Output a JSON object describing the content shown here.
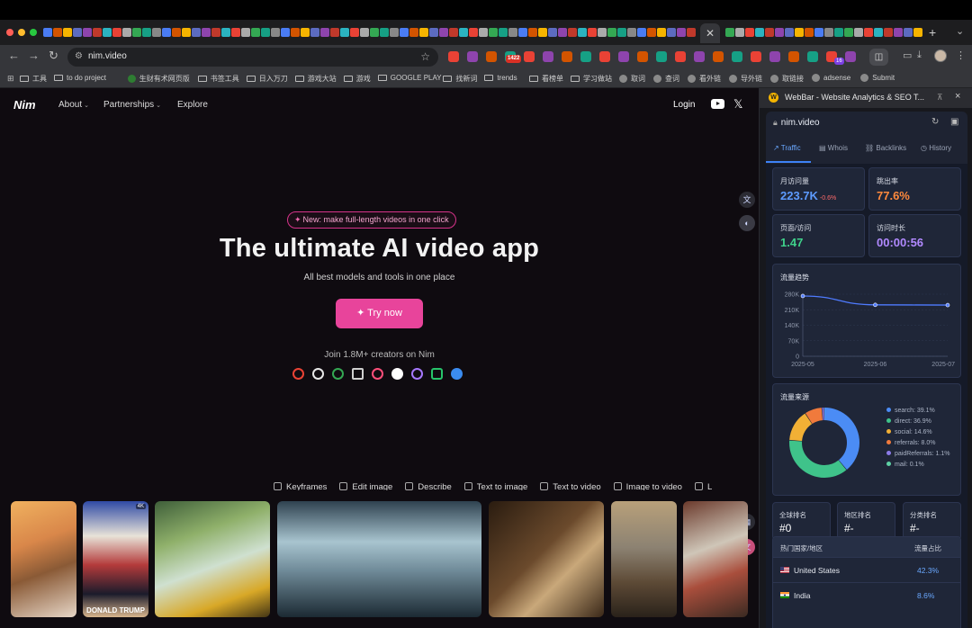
{
  "browser": {
    "url": "nim.video",
    "ext_badge_1": "1422",
    "ext_badge_2": "16",
    "bookmarks": [
      {
        "label": "工具",
        "kind": "folder"
      },
      {
        "label": "to do project",
        "kind": "folder"
      },
      {
        "label": "生财有术网页版",
        "kind": "leaf"
      },
      {
        "label": "书签工具",
        "kind": "folder"
      },
      {
        "label": "日入万刀",
        "kind": "folder"
      },
      {
        "label": "游戏大站",
        "kind": "folder"
      },
      {
        "label": "游戏",
        "kind": "folder"
      },
      {
        "label": "GOOGLE PLAY",
        "kind": "folder"
      },
      {
        "label": "找新词",
        "kind": "folder"
      },
      {
        "label": "trends",
        "kind": "folder"
      },
      {
        "label": "看榜单",
        "kind": "folder"
      },
      {
        "label": "学习做站",
        "kind": "folder"
      },
      {
        "label": "取词",
        "kind": "globe"
      },
      {
        "label": "查词",
        "kind": "globe"
      },
      {
        "label": "看外链",
        "kind": "globe"
      },
      {
        "label": "导外链",
        "kind": "globe"
      },
      {
        "label": "取链接",
        "kind": "globe"
      },
      {
        "label": "adsense",
        "kind": "globe"
      },
      {
        "label": "Submit",
        "kind": "globe"
      }
    ]
  },
  "site": {
    "logo": "Nim",
    "nav": {
      "about": "About",
      "partnerships": "Partnerships",
      "explore": "Explore",
      "login": "Login"
    },
    "pill": "New: make full-length videos in one click",
    "headline": "The ultimate AI video app",
    "subline": "All best models and tools in one place",
    "cta": "Try now",
    "join": "Join 1.8M+ creators on Nim",
    "tools": [
      "Keyframes",
      "Edit image",
      "Describe",
      "Text to image",
      "Text to video",
      "Image to video",
      "L"
    ],
    "gallery_caption": "DONALD TRUMP",
    "gallery_badge": "4K"
  },
  "panel": {
    "title": "WebBar - Website Analytics & SEO T...",
    "domain": "nim.video",
    "tabs": [
      "Traffic",
      "Whois",
      "Backlinks",
      "History"
    ],
    "stats": {
      "monthly_visits_label": "月访问量",
      "monthly_visits_value": "223.7K",
      "monthly_visits_change": "-0.6%",
      "bounce_label": "跳出率",
      "bounce_value": "77.6%",
      "pages_label": "页面/访问",
      "pages_value": "1.47",
      "duration_label": "访问时长",
      "duration_value": "00:00:56"
    },
    "trend_title": "流量趋势",
    "source_title": "流量来源",
    "ranks": [
      {
        "label": "全球排名",
        "value": "#0"
      },
      {
        "label": "地区排名",
        "value": "#-"
      },
      {
        "label": "分类排名",
        "value": "#-"
      }
    ],
    "countries": {
      "header_country": "热门国家/地区",
      "header_share": "流量占比",
      "rows": [
        {
          "name": "United States",
          "share": "42.3%"
        },
        {
          "name": "India",
          "share": "8.6%"
        }
      ]
    }
  },
  "chart_data": [
    {
      "type": "line",
      "title": "流量趋势",
      "x": [
        "2025-05",
        "2025-06",
        "2025-07"
      ],
      "values": [
        272000,
        232000,
        231000
      ],
      "ylim": [
        0,
        280000
      ],
      "yticks": [
        "0",
        "70K",
        "140K",
        "210K",
        "280K"
      ],
      "grid": true,
      "color": "#4f7bff"
    },
    {
      "type": "pie",
      "title": "流量来源",
      "legend_position": "right",
      "labels": [
        "search: 39.1%",
        "direct: 36.9%",
        "social: 14.6%",
        "referrals: 8.0%",
        "paidReferrals: 1.1%",
        "mail: 0.1%"
      ],
      "values": [
        39.1,
        36.9,
        14.6,
        8.0,
        1.1,
        0.1
      ],
      "colors": [
        "#4b8cf5",
        "#3fc38a",
        "#f2b035",
        "#f07a3c",
        "#8b7be8",
        "#5ed1a5"
      ]
    }
  ]
}
